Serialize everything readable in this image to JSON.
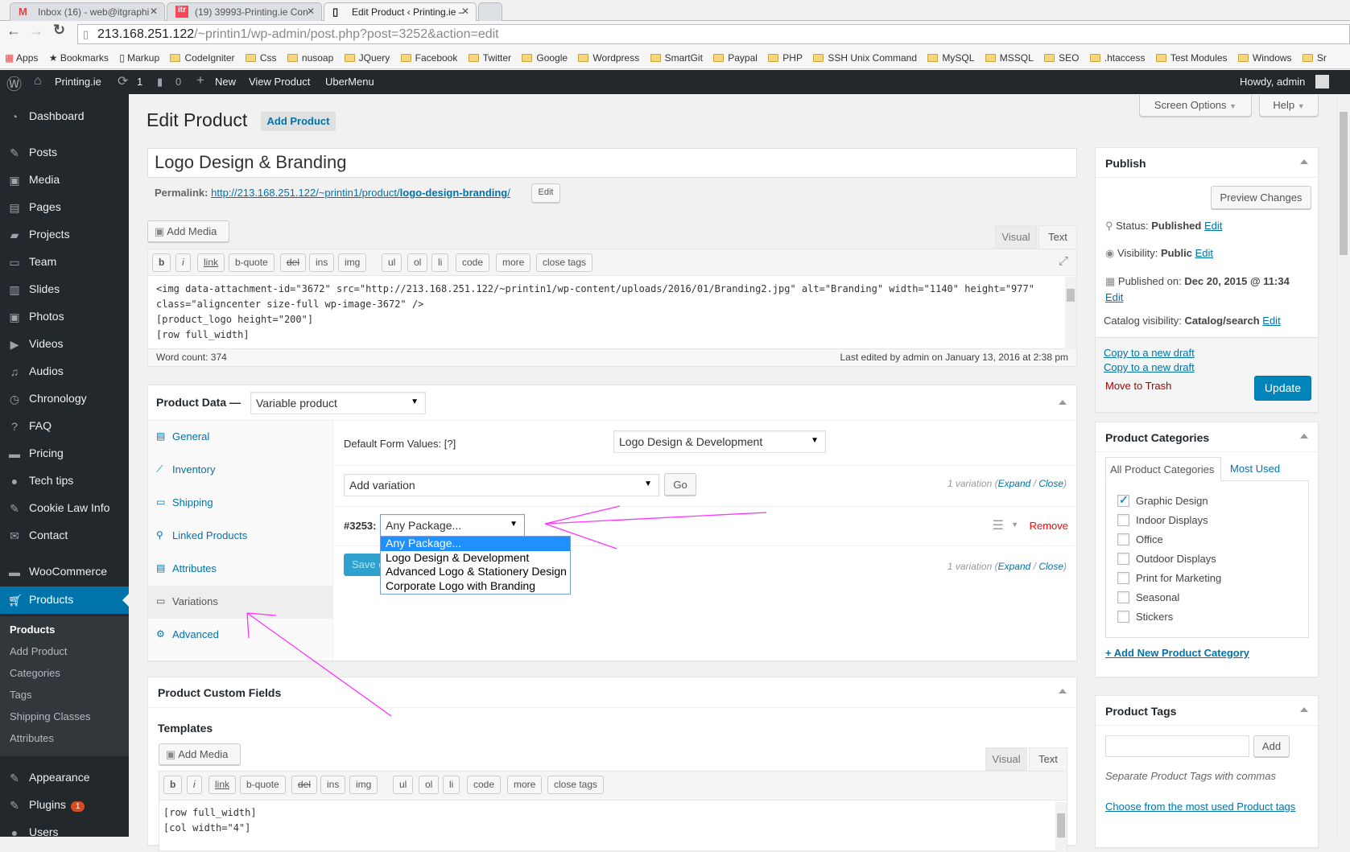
{
  "browser": {
    "tabs": [
      {
        "title": "Inbox (16) - web@itgraphi",
        "icon": "gmail-icon"
      },
      {
        "title": "(19) 39993-Printing.ie Con",
        "icon": "app-icon"
      },
      {
        "title": "Edit Product ‹ Printing.ie –",
        "icon": "page-icon"
      }
    ],
    "url_host": "213.168.251.122",
    "url_path": "/~printin1/wp-admin/post.php?post=3252&action=edit",
    "bookmarks": [
      "Apps",
      "Bookmarks",
      "Markup",
      "CodeIgniter",
      "Css",
      "nusoap",
      "JQuery",
      "Facebook",
      "Twitter",
      "Google",
      "Wordpress",
      "SmartGit",
      "Paypal",
      "PHP",
      "SSH Unix Command",
      "MySQL",
      "MSSQL",
      "SEO",
      ".htaccess",
      "Test Modules",
      "Windows",
      "Sr"
    ]
  },
  "adminbar": {
    "site": "Printing.ie",
    "updates": "1",
    "comments": "0",
    "new": "New",
    "view": "View Product",
    "ubermenu": "UberMenu",
    "howdy": "Howdy, admin"
  },
  "sidebar": {
    "items": [
      "Dashboard",
      "Posts",
      "Media",
      "Pages",
      "Projects",
      "Team",
      "Slides",
      "Photos",
      "Videos",
      "Audios",
      "Chronology",
      "FAQ",
      "Pricing",
      "Tech tips",
      "Cookie Law Info",
      "Contact",
      "WooCommerce",
      "Products",
      "Appearance",
      "Plugins",
      "Users"
    ],
    "active": "Products",
    "submenu": [
      "Products",
      "Add Product",
      "Categories",
      "Tags",
      "Shipping Classes",
      "Attributes"
    ],
    "plugins_badge": "1"
  },
  "header": {
    "title": "Edit Product",
    "add_new": "Add Product",
    "screen_options": "Screen Options",
    "help": "Help"
  },
  "post": {
    "title": "Logo Design & Branding",
    "permalink_label": "Permalink:",
    "permalink_base": "http://213.168.251.122/~printin1/product/",
    "permalink_slug": "logo-design-branding",
    "permalink_end": "/",
    "permalink_edit": "Edit",
    "add_media": "Add Media",
    "tab_visual": "Visual",
    "tab_text": "Text",
    "quicktags": [
      "b",
      "i",
      "link",
      "b-quote",
      "del",
      "ins",
      "img",
      "ul",
      "ol",
      "li",
      "code",
      "more",
      "close tags"
    ],
    "content_lines": [
      "<img data-attachment-id=\"3672\" src=\"http://213.168.251.122/~printin1/wp-content/uploads/2016/01/Branding2.jpg\" alt=\"Branding\" width=\"1140\" height=\"977\"",
      "class=\"aligncenter size-full wp-image-3672\" />",
      "[product_logo height=\"200\"]",
      "[row full_width]"
    ],
    "word_count": "Word count: 374",
    "last_edited": "Last edited by admin on January 13, 2016 at 2:38 pm"
  },
  "product_data": {
    "label": "Product Data —",
    "type": "Variable product",
    "tabs": [
      "General",
      "Inventory",
      "Shipping",
      "Linked Products",
      "Attributes",
      "Variations",
      "Advanced"
    ],
    "selected_tab": "Variations",
    "default_form_label": "Default Form Values: [?]",
    "default_form_value": "Logo Design & Development",
    "add_variation": "Add variation",
    "go": "Go",
    "variation_count": "1 variation",
    "expand": "Expand",
    "close": "Close",
    "variation_id": "#3253:",
    "variation_value": "Any Package...",
    "remove": "Remove",
    "save": "Save changes",
    "dropdown_options": [
      "Any Package...",
      "Logo Design & Development",
      "Advanced Logo & Stationery Design",
      "Corporate Logo with Branding"
    ],
    "highlighted_option": "Any Package..."
  },
  "custom_fields": {
    "title": "Product Custom Fields",
    "templates": "Templates",
    "add_media": "Add Media",
    "tab_visual": "Visual",
    "tab_text": "Text",
    "content_lines": [
      "[row full_width]",
      "[col width=\"4\"]"
    ]
  },
  "publish": {
    "title": "Publish",
    "preview": "Preview Changes",
    "status_label": "Status:",
    "status": "Published",
    "visibility_label": "Visibility:",
    "visibility": "Public",
    "published_label": "Published on:",
    "published": "Dec 20, 2015 @ 11:34",
    "catalog_label": "Catalog visibility:",
    "catalog": "Catalog/search",
    "edit": "Edit",
    "copy1": "Copy to a new draft",
    "copy2": "Copy to a new draft",
    "trash": "Move to Trash",
    "update": "Update"
  },
  "categories": {
    "title": "Product Categories",
    "tab_all": "All Product Categories",
    "tab_used": "Most Used",
    "items": [
      {
        "label": "Graphic Design",
        "checked": true
      },
      {
        "label": "Indoor Displays",
        "checked": false
      },
      {
        "label": "Office",
        "checked": false
      },
      {
        "label": "Outdoor Displays",
        "checked": false
      },
      {
        "label": "Print for Marketing",
        "checked": false
      },
      {
        "label": "Seasonal",
        "checked": false
      },
      {
        "label": "Stickers",
        "checked": false
      }
    ],
    "add_new": "+ Add New Product Category"
  },
  "tags": {
    "title": "Product Tags",
    "input_value": "",
    "add": "Add",
    "hint": "Separate Product Tags with commas",
    "choose": "Choose from the most used Product tags"
  },
  "colors": {
    "accent": "#0073aa",
    "sidebar": "#23282d",
    "remove": "#a00",
    "annotation": "#ff33ff"
  }
}
